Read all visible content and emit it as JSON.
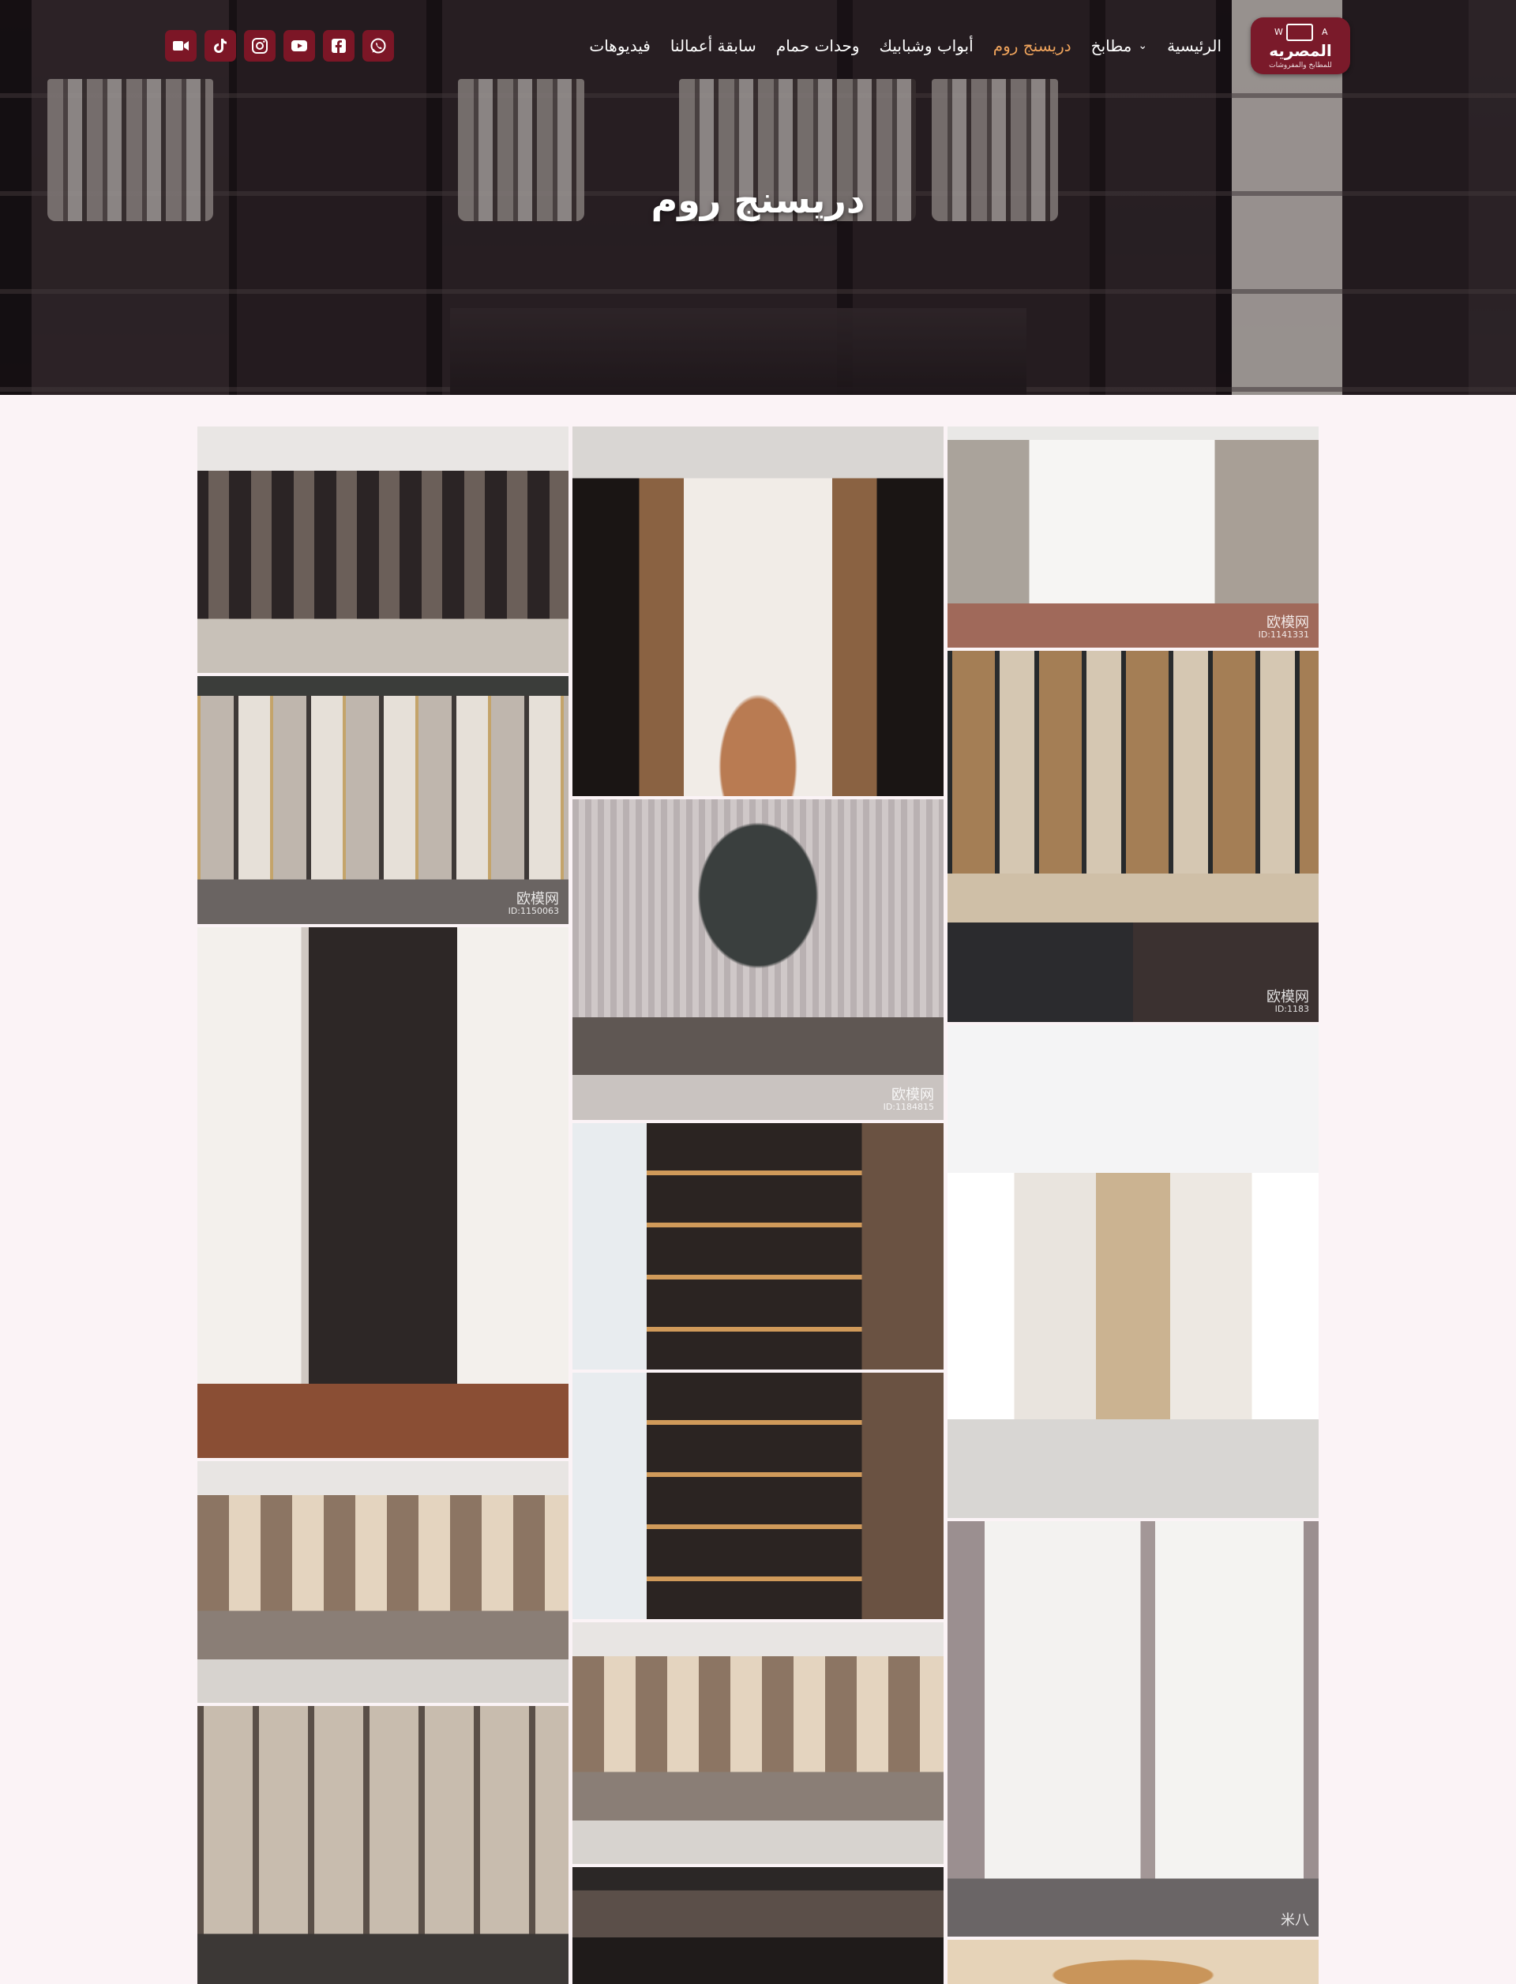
{
  "page": {
    "hero_title": "دريسنج روم"
  },
  "logo": {
    "name": "المصريه",
    "tagline": "للمطابخ والمفروشات",
    "left_letter": "W",
    "right_letter": "A"
  },
  "nav": {
    "items": [
      {
        "label": "الرئيسية",
        "active": false,
        "has_dropdown": false
      },
      {
        "label": "مطابخ",
        "active": false,
        "has_dropdown": true
      },
      {
        "label": "دريسنج روم",
        "active": true,
        "has_dropdown": false
      },
      {
        "label": "أبواب وشبابيك",
        "active": false,
        "has_dropdown": false
      },
      {
        "label": "وحدات حمام",
        "active": false,
        "has_dropdown": false
      },
      {
        "label": "سابقة أعمالنا",
        "active": false,
        "has_dropdown": false
      },
      {
        "label": "فيديوهات",
        "active": false,
        "has_dropdown": false
      }
    ],
    "active_color": "#f0a45c"
  },
  "social": {
    "icons": [
      "whatsapp-icon",
      "facebook-icon",
      "youtube-icon",
      "instagram-icon",
      "tiktok-icon",
      "video-camera-icon"
    ],
    "color": "#7c1626"
  },
  "gallery": {
    "watermarks": [
      {
        "brand": "欧模网",
        "id": "ID:1141331"
      },
      {
        "brand": "欧模网",
        "id": "ID:1150063"
      },
      {
        "brand": "欧模网",
        "id": "ID:1184815"
      },
      {
        "brand": "欧模网",
        "id": "ID:1183"
      },
      {
        "brand": "米八",
        "id": ""
      }
    ]
  }
}
